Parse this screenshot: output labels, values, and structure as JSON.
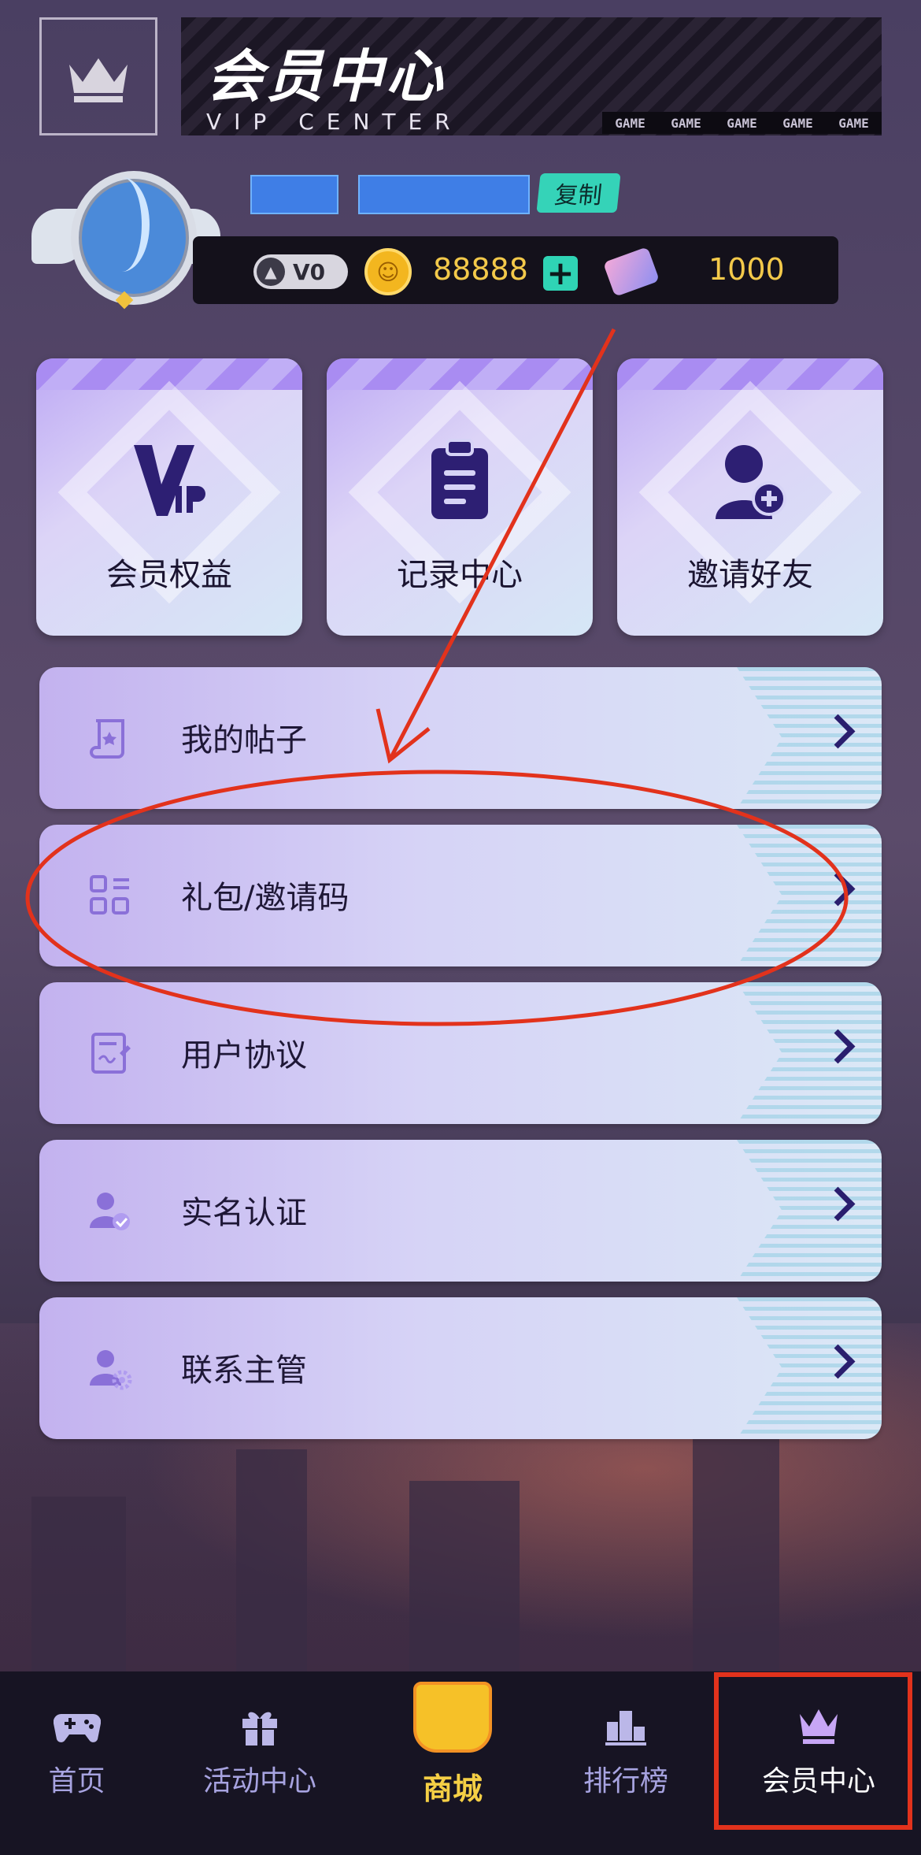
{
  "header": {
    "title_cn": "会员中心",
    "title_en": "VIP CENTER",
    "game_strip": [
      "GAME",
      "GAME",
      "GAME",
      "GAME",
      "GAME"
    ]
  },
  "profile": {
    "copy_label": "复制",
    "level_label": "V0",
    "coins": "88888",
    "tickets": "1000"
  },
  "cards": [
    {
      "label": "会员权益",
      "icon": "vip-icon"
    },
    {
      "label": "记录中心",
      "icon": "clipboard-icon"
    },
    {
      "label": "邀请好友",
      "icon": "add-user-icon"
    }
  ],
  "menu": [
    {
      "label": "我的帖子",
      "icon": "scroll-star-icon"
    },
    {
      "label": "礼包/邀请码",
      "icon": "qr-grid-icon"
    },
    {
      "label": "用户协议",
      "icon": "document-sign-icon"
    },
    {
      "label": "实名认证",
      "icon": "user-check-icon"
    },
    {
      "label": "联系主管",
      "icon": "user-settings-icon"
    }
  ],
  "nav": [
    {
      "label": "首页",
      "icon": "gamepad-icon"
    },
    {
      "label": "活动中心",
      "icon": "gift-icon"
    },
    {
      "label": "商城",
      "icon": "shopping-cart-icon"
    },
    {
      "label": "排行榜",
      "icon": "podium-icon"
    },
    {
      "label": "会员中心",
      "icon": "crown-icon",
      "active": true
    }
  ],
  "colors": {
    "accent_teal": "#35d3b8",
    "coin_gold": "#f3c94a",
    "nav_bg": "#171423",
    "nav_label": "#a7a3e0",
    "annotation_red": "#e2321c"
  }
}
